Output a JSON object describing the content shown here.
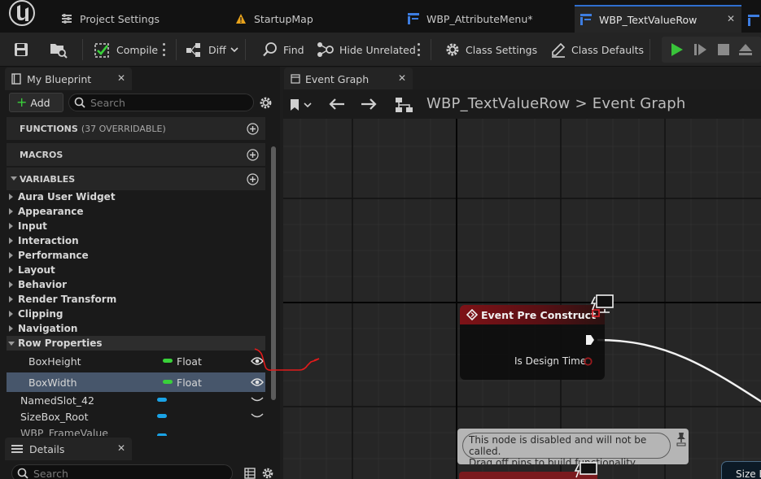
{
  "tabs": [
    {
      "label": "Project Settings",
      "icon": "settings-sliders-icon",
      "active": false
    },
    {
      "label": "StartupMap",
      "icon": "map-warning-icon",
      "active": false
    },
    {
      "label": "WBP_AttributeMenu*",
      "icon": "widget-blueprint-icon",
      "active": false
    },
    {
      "label": "WBP_TextValueRow",
      "icon": "widget-blueprint-icon",
      "active": true
    }
  ],
  "toolbar": {
    "compile": "Compile",
    "diff": "Diff",
    "find": "Find",
    "hide_unrelated": "Hide Unrelated",
    "class_settings": "Class Settings",
    "class_defaults": "Class Defaults"
  },
  "my_blueprint": {
    "tab_label": "My Blueprint",
    "add_label": "Add",
    "search_placeholder": "Search",
    "functions_label": "FUNCTIONS",
    "functions_sub": "(37 OVERRIDABLE)",
    "macros_label": "MACROS",
    "variables_label": "VARIABLES",
    "categories": [
      "Aura User Widget",
      "Appearance",
      "Input",
      "Interaction",
      "Performance",
      "Layout",
      "Behavior",
      "Render Transform",
      "Clipping",
      "Navigation"
    ],
    "open_category": "Row Properties",
    "variables": [
      {
        "name": "BoxHeight",
        "type": "Float",
        "type_color": "#39d13a",
        "selected": false
      },
      {
        "name": "BoxWidth",
        "type": "Float",
        "type_color": "#39d13a",
        "selected": true
      },
      {
        "name": "NamedSlot_42",
        "type": "",
        "type_color": "#1aa3e6",
        "selected": false
      },
      {
        "name": "SizeBox_Root",
        "type": "",
        "type_color": "#1aa3e6",
        "selected": false
      },
      {
        "name": "WBP_FrameValue",
        "type": "",
        "type_color": "#1aa3e6",
        "selected": false
      }
    ]
  },
  "details": {
    "tab_label": "Details",
    "search_placeholder": "Search"
  },
  "graph": {
    "tab_label": "Event Graph",
    "breadcrumb_blueprint": "WBP_TextValueRow",
    "breadcrumb_sep": ">",
    "breadcrumb_graph": "Event Graph",
    "node_title": "Event Pre Construct",
    "node_pin_label": "Is Design Time",
    "comment_line1": "This node is disabled and will not be called.",
    "comment_line2": "Drag off pins to build functionality.",
    "partial_node_label": "Size B"
  }
}
